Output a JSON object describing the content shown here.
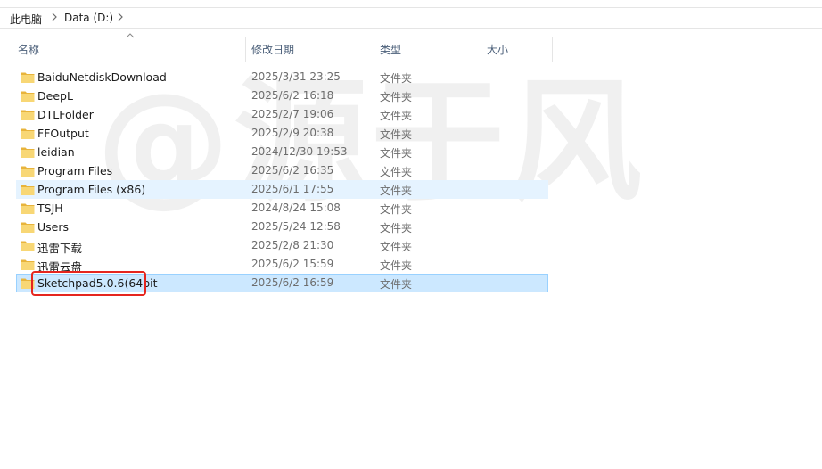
{
  "breadcrumb": {
    "root": "此电脑",
    "drive": "Data (D:)"
  },
  "columns": {
    "name": "名称",
    "date": "修改日期",
    "type": "类型",
    "size": "大小"
  },
  "files": [
    {
      "name": "BaiduNetdiskDownload",
      "date": "2025/3/31 23:25",
      "type": "文件夹",
      "state": ""
    },
    {
      "name": "DeepL",
      "date": "2025/6/2 16:18",
      "type": "文件夹",
      "state": ""
    },
    {
      "name": "DTLFolder",
      "date": "2025/2/7 19:06",
      "type": "文件夹",
      "state": ""
    },
    {
      "name": "FFOutput",
      "date": "2025/2/9 20:38",
      "type": "文件夹",
      "state": ""
    },
    {
      "name": "leidian",
      "date": "2024/12/30 19:53",
      "type": "文件夹",
      "state": ""
    },
    {
      "name": "Program Files",
      "date": "2025/6/2 16:35",
      "type": "文件夹",
      "state": ""
    },
    {
      "name": "Program Files (x86)",
      "date": "2025/6/1 17:55",
      "type": "文件夹",
      "state": "hover"
    },
    {
      "name": "TSJH",
      "date": "2024/8/24 15:08",
      "type": "文件夹",
      "state": ""
    },
    {
      "name": "Users",
      "date": "2025/5/24 12:58",
      "type": "文件夹",
      "state": ""
    },
    {
      "name": "迅雷下载",
      "date": "2025/2/8 21:30",
      "type": "文件夹",
      "state": ""
    },
    {
      "name": "迅雷云盘",
      "date": "2025/6/2 15:59",
      "type": "文件夹",
      "state": ""
    },
    {
      "name": "Sketchpad5.0.6(64bit",
      "date": "2025/6/2 16:59",
      "type": "文件夹",
      "state": "selected"
    }
  ],
  "watermark": "@源于风",
  "colors": {
    "selected_bg": "#cce8ff",
    "hover_bg": "#e5f3ff",
    "annotation": "#e5261f",
    "folder": "#f8d775"
  }
}
